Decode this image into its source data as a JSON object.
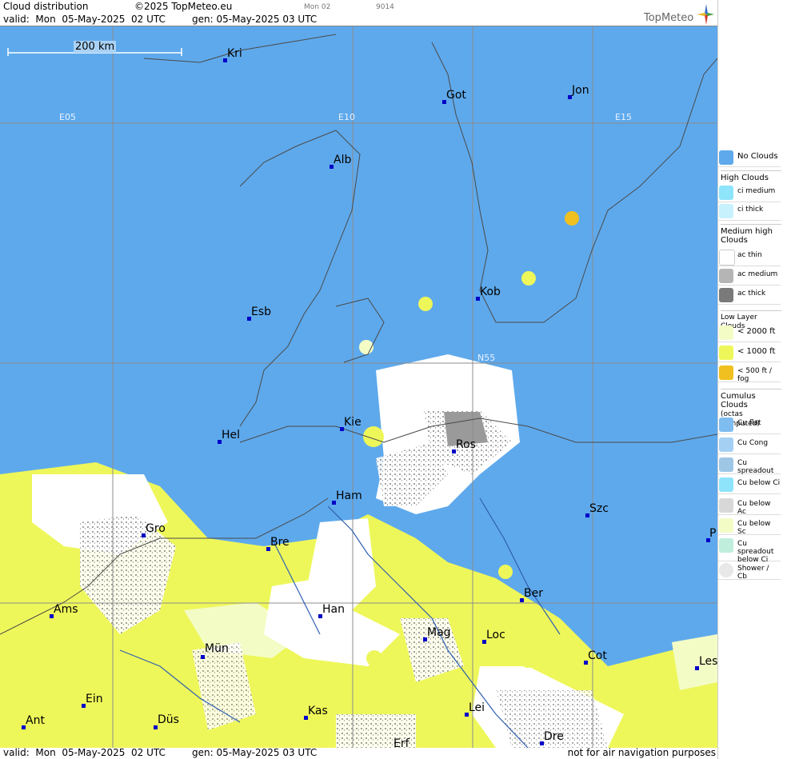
{
  "header": {
    "title": "Cloud distribution",
    "copyright": "©2025 TopMeteo.eu",
    "mini_time": "Mon 02",
    "mini_code": "9014",
    "valid": "valid:  Mon  05-May-2025  02 UTC",
    "gen": "gen: 05-May-2025 03 UTC",
    "brand": "TopMeteo"
  },
  "scale": {
    "label": "200 km"
  },
  "grid": {
    "meridians": [
      "E05",
      "E10",
      "E15"
    ],
    "parallels": [
      "N55"
    ]
  },
  "cities": [
    {
      "name": "Kri"
    },
    {
      "name": "Got"
    },
    {
      "name": "Jon"
    },
    {
      "name": "Alb"
    },
    {
      "name": "Kob"
    },
    {
      "name": "Esb"
    },
    {
      "name": "Kie"
    },
    {
      "name": "Ros"
    },
    {
      "name": "Hel"
    },
    {
      "name": "Ham"
    },
    {
      "name": "Szc"
    },
    {
      "name": "Gro"
    },
    {
      "name": "Bre"
    },
    {
      "name": "Ber"
    },
    {
      "name": "Ams"
    },
    {
      "name": "Han"
    },
    {
      "name": "Mag"
    },
    {
      "name": "Loc"
    },
    {
      "name": "Mün"
    },
    {
      "name": "Cot"
    },
    {
      "name": "Les"
    },
    {
      "name": "Ein"
    },
    {
      "name": "Kas"
    },
    {
      "name": "Lei"
    },
    {
      "name": "Ant"
    },
    {
      "name": "Düs"
    },
    {
      "name": "Dre"
    },
    {
      "name": "Erf"
    },
    {
      "name": "P"
    }
  ],
  "footer": {
    "valid": "valid:  Mon  05-May-2025  02 UTC",
    "gen": "gen: 05-May-2025 03 UTC",
    "note": "not for air navigation purposes"
  },
  "legend": {
    "no_clouds": "No Clouds",
    "high_head": "High Clouds",
    "high": [
      "ci medium",
      "ci thick"
    ],
    "medium_head": "Medium high Clouds",
    "medium": [
      "ac thin",
      "ac medium",
      "ac thick"
    ],
    "low_head": "Low Layer Clouds",
    "low": [
      "< 2000 ft",
      "< 1000 ft",
      "< 500 ft / fog"
    ],
    "cu_head": "Cumulus Clouds",
    "cu_sub": "(octas computed)",
    "cu": [
      "Cu flat",
      "Cu Cong",
      "Cu spreadout",
      "Cu below Ci",
      "Cu below Ac",
      "Cu below Sc",
      "Cu spreadout below Ci",
      "Shower / Cb"
    ]
  },
  "colors": {
    "sky": "#5ea9ec",
    "white_cloud": "#ffffff",
    "low_2000": "#f4fcc6",
    "low_1000": "#eef75a",
    "fog": "#f0c020",
    "ac_medium": "#b5b5b5",
    "ac_thick": "#7a7a7a",
    "ci": "#8ee4fb"
  }
}
